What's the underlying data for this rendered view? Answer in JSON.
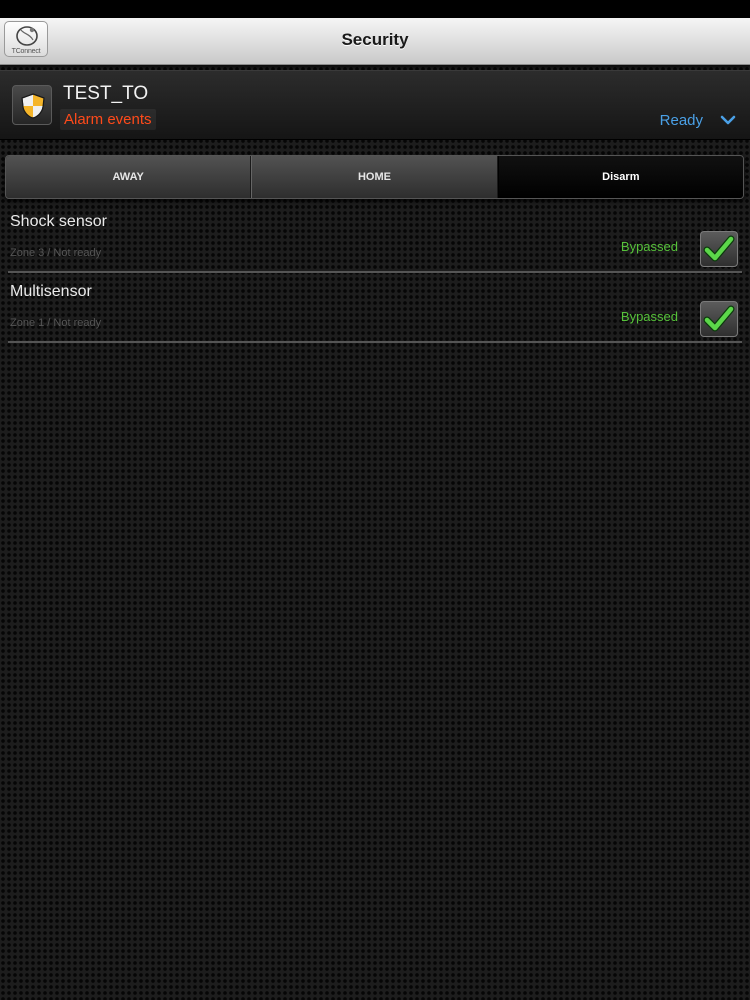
{
  "header": {
    "title": "Security",
    "logo_text": "TConnect"
  },
  "panel": {
    "site_name": "TEST_TO",
    "alarm_events_label": "Alarm events",
    "status": "Ready"
  },
  "mode_tabs": [
    {
      "label": "AWAY",
      "active": false
    },
    {
      "label": "HOME",
      "active": false
    },
    {
      "label": "Disarm",
      "active": true
    }
  ],
  "zones": [
    {
      "name": "Shock sensor",
      "detail": "Zone 3 / Not ready",
      "status": "Bypassed",
      "checked": true
    },
    {
      "name": "Multisensor",
      "detail": "Zone 1 / Not ready",
      "status": "Bypassed",
      "checked": true
    }
  ],
  "colors": {
    "alarm_events": "#ff4a1a",
    "ready_status": "#4aa0e6",
    "bypassed_status": "#56c23a"
  },
  "icons": {
    "logo": "tconnect-logo-icon",
    "shield": "shield-icon",
    "chevron": "chevron-down-icon",
    "check": "check-icon"
  }
}
